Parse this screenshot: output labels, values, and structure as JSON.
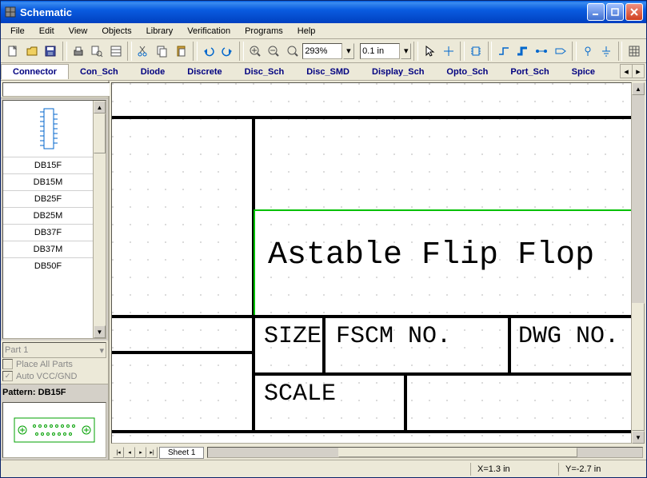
{
  "window": {
    "title": "Schematic"
  },
  "menu": {
    "items": [
      "File",
      "Edit",
      "View",
      "Objects",
      "Library",
      "Verification",
      "Programs",
      "Help"
    ]
  },
  "toolbar": {
    "zoom": "293%",
    "grid": "0.1 in"
  },
  "tabs": {
    "items": [
      "Connector",
      "Con_Sch",
      "Diode",
      "Discrete",
      "Disc_Sch",
      "Disc_SMD",
      "Display_Sch",
      "Opto_Sch",
      "Port_Sch",
      "Spice"
    ],
    "active": 0
  },
  "parts": {
    "items": [
      "DB15F",
      "DB15M",
      "DB25F",
      "DB25M",
      "DB37F",
      "DB37M",
      "DB50F"
    ]
  },
  "partPanel": {
    "dropdown": "Part 1",
    "placeAll": "Place All Parts",
    "autoVcc": "Auto VCC/GND",
    "patternLabel": "Pattern:",
    "patternValue": "DB15F"
  },
  "schematic": {
    "title": "Astable Flip Flop",
    "size": "SIZE",
    "fscm": "FSCM NO.",
    "dwg": "DWG NO.",
    "scale": "SCALE"
  },
  "sheet": {
    "name": "Sheet 1"
  },
  "status": {
    "x": "X=1.3 in",
    "y": "Y=-2.7 in"
  }
}
